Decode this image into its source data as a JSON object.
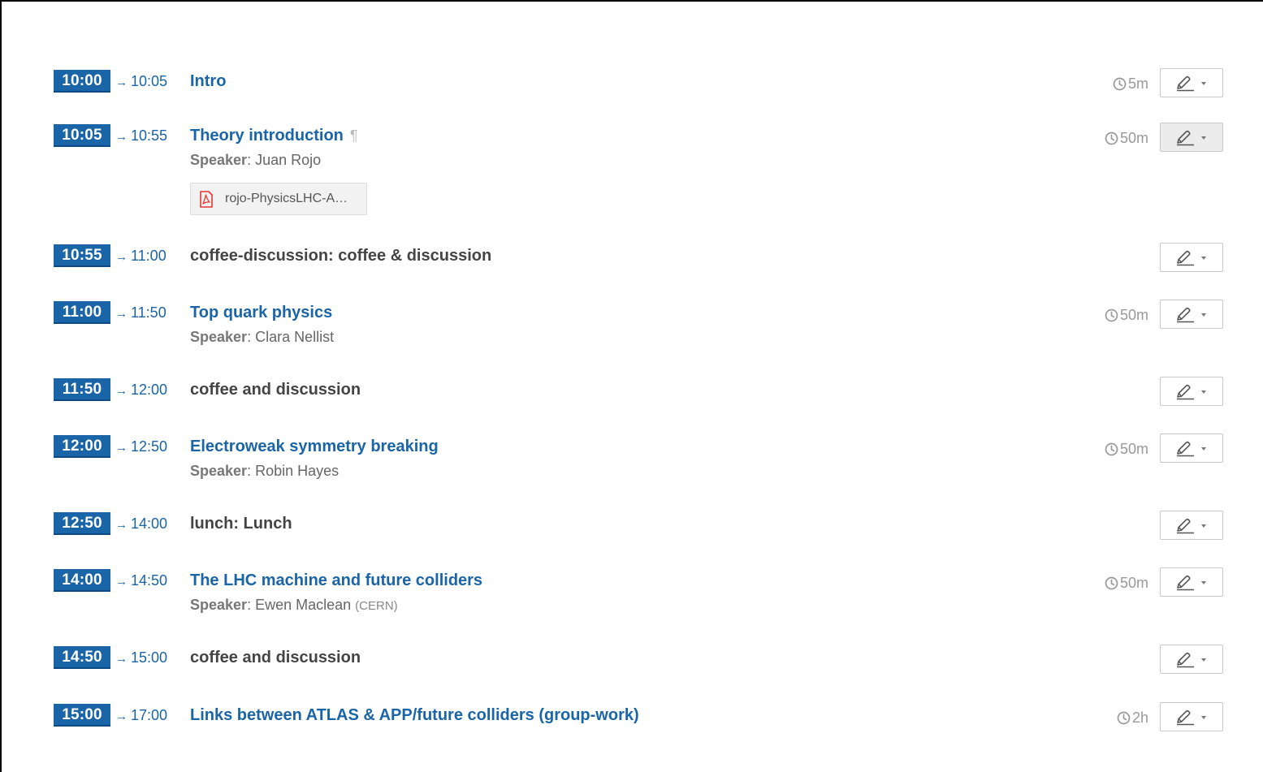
{
  "entries": [
    {
      "start": "10:00",
      "end": "10:05",
      "title": "Intro",
      "kind": "contribution",
      "duration": "5m"
    },
    {
      "start": "10:05",
      "end": "10:55",
      "title": "Theory introduction",
      "kind": "contribution",
      "duration": "50m",
      "has_description": true,
      "speaker_label": "Speaker",
      "speaker": "Juan Rojo",
      "attachment": "rojo-PhysicsLHC-A…",
      "button_pressed": true
    },
    {
      "start": "10:55",
      "end": "11:00",
      "title": "coffee-discussion: coffee & discussion",
      "kind": "break"
    },
    {
      "start": "11:00",
      "end": "11:50",
      "title": "Top quark physics",
      "kind": "contribution",
      "duration": "50m",
      "speaker_label": "Speaker",
      "speaker": "Clara Nellist"
    },
    {
      "start": "11:50",
      "end": "12:00",
      "title": "coffee and discussion",
      "kind": "break"
    },
    {
      "start": "12:00",
      "end": "12:50",
      "title": "Electroweak symmetry breaking",
      "kind": "contribution",
      "duration": "50m",
      "speaker_label": "Speaker",
      "speaker": "Robin Hayes"
    },
    {
      "start": "12:50",
      "end": "14:00",
      "title": "lunch: Lunch",
      "kind": "break"
    },
    {
      "start": "14:00",
      "end": "14:50",
      "title": "The LHC machine and future colliders",
      "kind": "contribution",
      "duration": "50m",
      "speaker_label": "Speaker",
      "speaker": "Ewen Maclean",
      "affiliation": "(CERN)"
    },
    {
      "start": "14:50",
      "end": "15:00",
      "title": "coffee and discussion",
      "kind": "break"
    },
    {
      "start": "15:00",
      "end": "17:00",
      "title": "Links between ATLAS & APP/future colliders (group-work)",
      "kind": "contribution",
      "duration": "2h"
    }
  ],
  "icons": {
    "arrow": "→",
    "pilcrow": "¶",
    "clock": "clock-icon",
    "pencil": "pencil-icon",
    "caret": "caret-down-icon",
    "pdf": "pdf-file-icon"
  },
  "colors": {
    "accent": "#1a64a8",
    "break_title": "#444444",
    "muted": "#999999",
    "pdf_red": "#e53935"
  }
}
